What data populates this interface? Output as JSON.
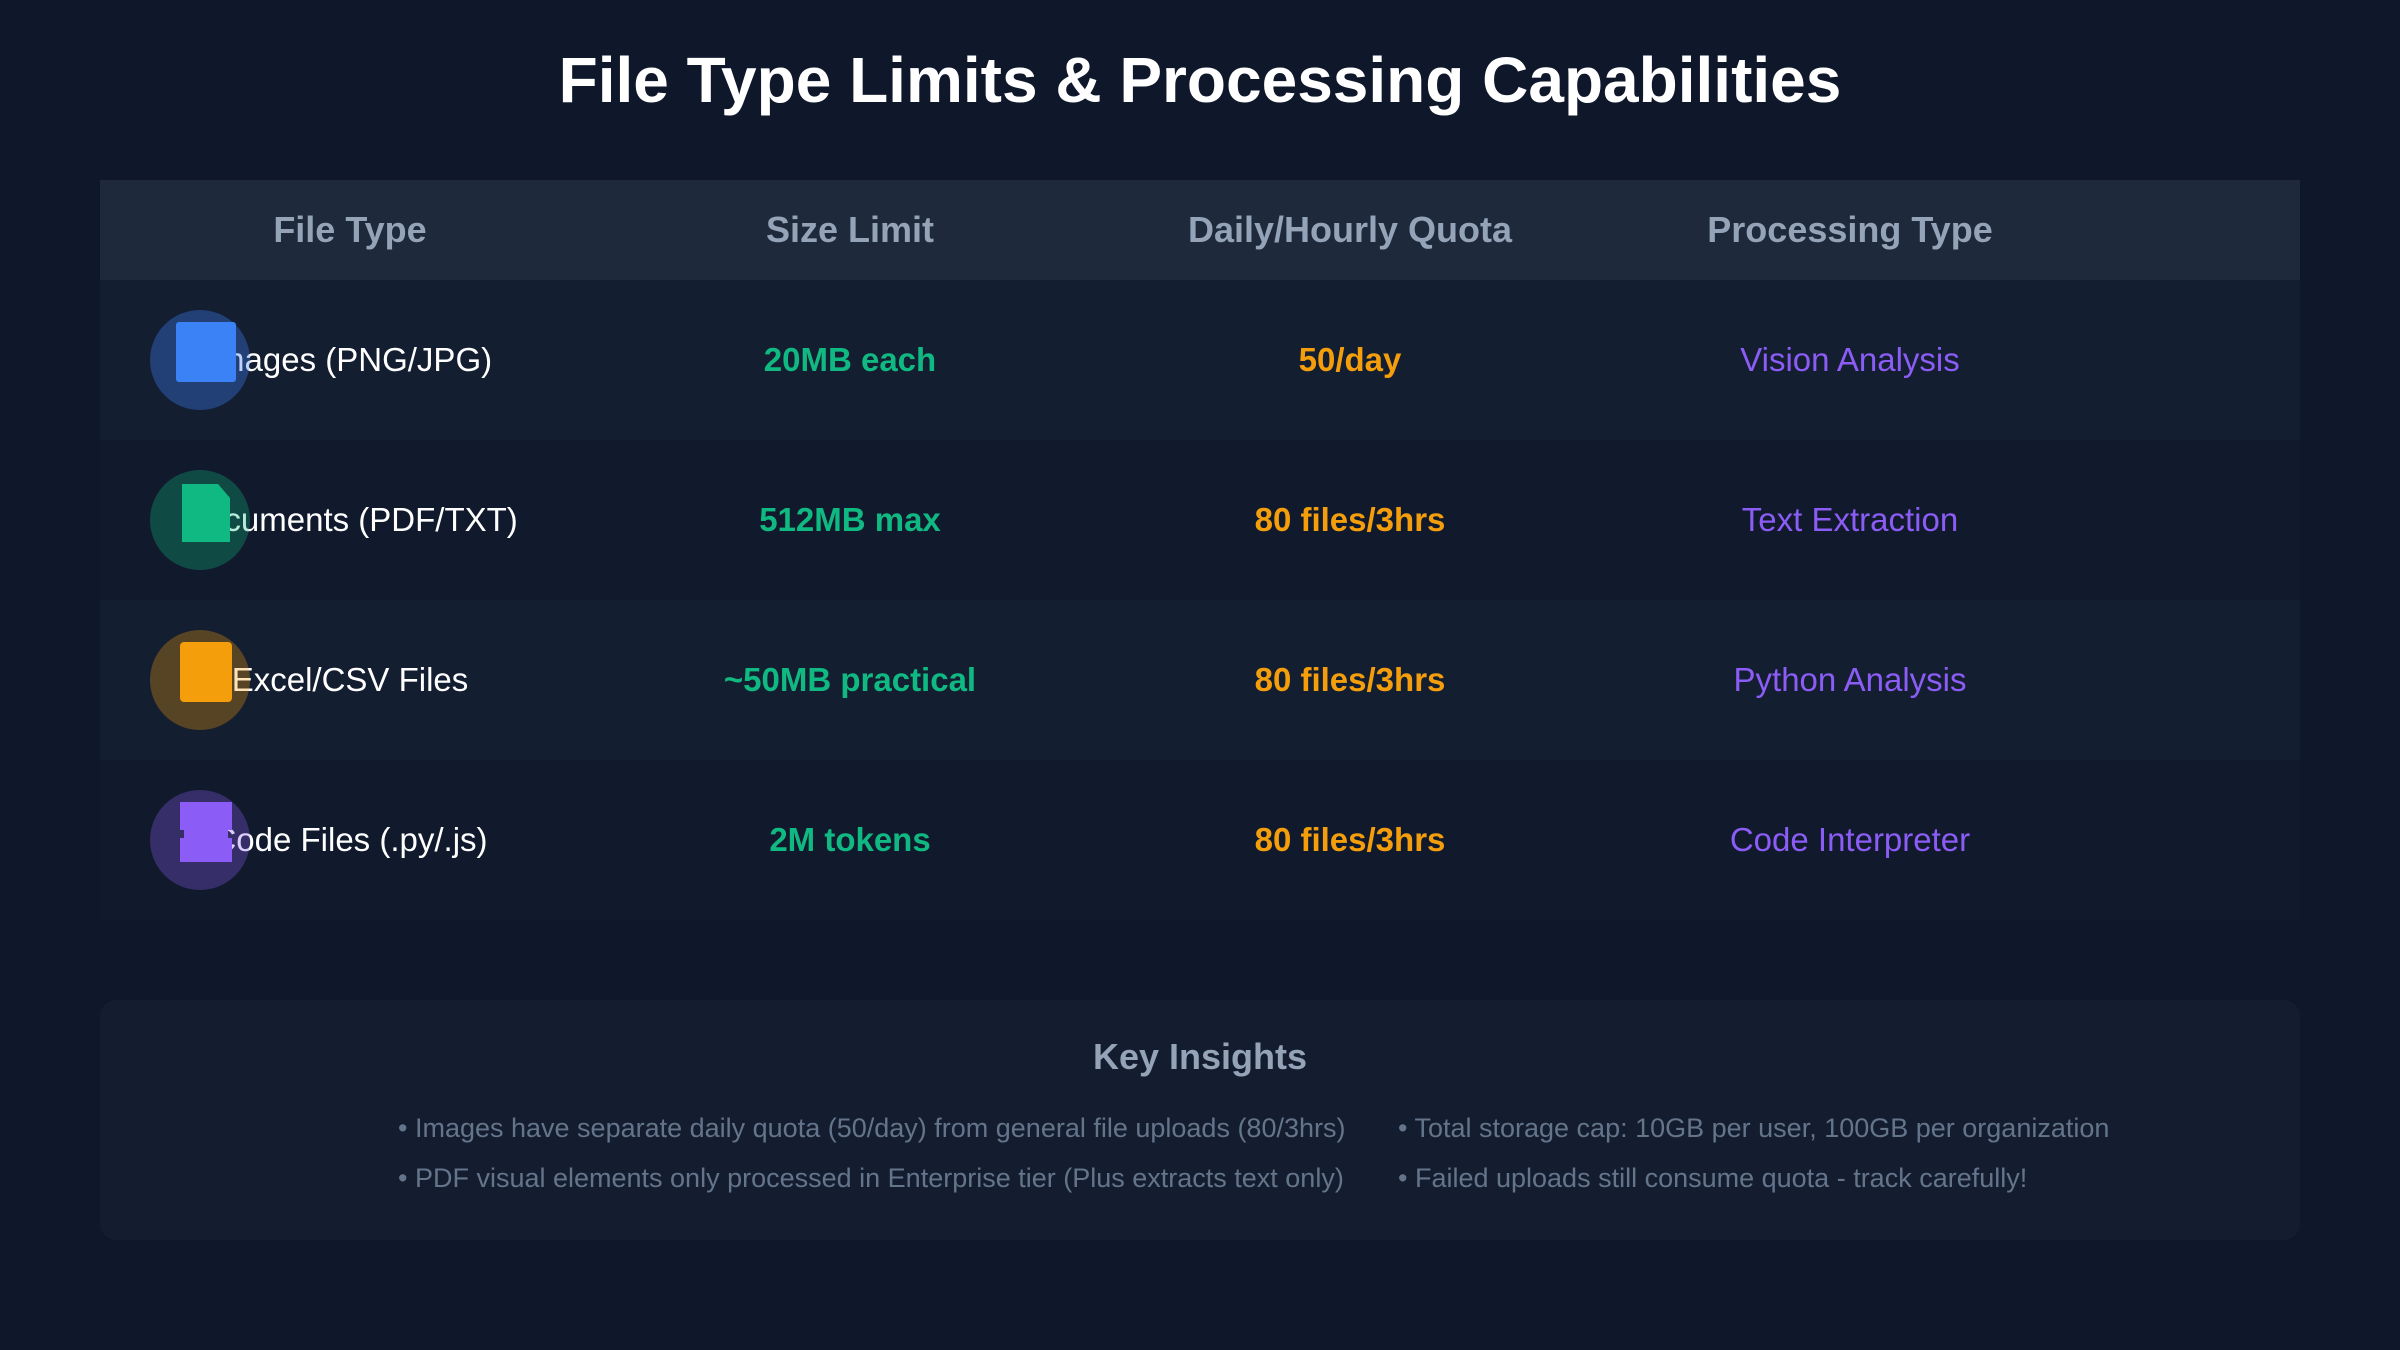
{
  "title": "File Type Limits & Processing Capabilities",
  "table": {
    "headers": [
      "File Type",
      "Size Limit",
      "Daily/Hourly Quota",
      "Processing Type"
    ],
    "rows": [
      {
        "icon": "image-icon",
        "icon_color": "#3b82f6",
        "file_type": "Images (PNG/JPG)",
        "size_limit": "20MB each",
        "quota": "50/day",
        "processing": "Vision Analysis"
      },
      {
        "icon": "document-icon",
        "icon_color": "#10b981",
        "file_type": "Documents (PDF/TXT)",
        "size_limit": "512MB max",
        "quota": "80 files/3hrs",
        "processing": "Text Extraction"
      },
      {
        "icon": "spreadsheet-icon",
        "icon_color": "#f59e0b",
        "file_type": "Excel/CSV Files",
        "size_limit": "~50MB practical",
        "quota": "80 files/3hrs",
        "processing": "Python Analysis"
      },
      {
        "icon": "code-icon",
        "icon_color": "#8b5cf6",
        "file_type": "Code Files (.py/.js)",
        "size_limit": "2M tokens",
        "quota": "80 files/3hrs",
        "processing": "Code Interpreter"
      }
    ]
  },
  "insights": {
    "title": "Key Insights",
    "bullets": [
      "• Images have separate daily quota (50/day) from general file uploads (80/3hrs)",
      "• Total storage cap: 10GB per user, 100GB per organization",
      "• PDF visual elements only processed in Enterprise tier (Plus extracts text only)",
      "• Failed uploads still consume quota - track carefully!"
    ]
  },
  "colors": {
    "background": "#0f172a",
    "size_text": "#10b981",
    "quota_text": "#f59e0b",
    "processing_text": "#8b5cf6"
  }
}
